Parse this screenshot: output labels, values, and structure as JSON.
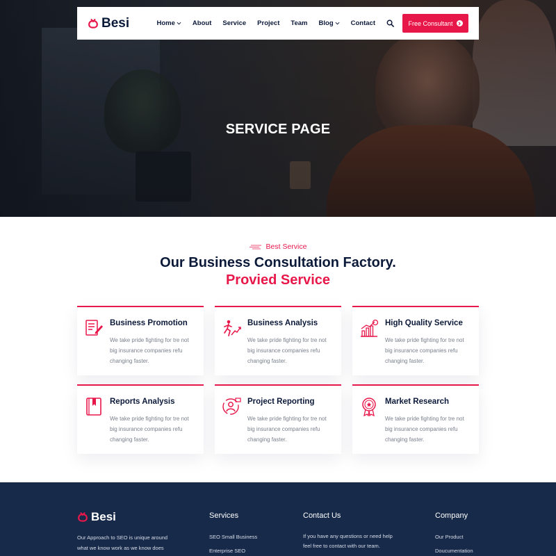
{
  "brand": {
    "name": "Besi",
    "accent": "#e8174a",
    "dark": "#0c1a3a",
    "footer_bg": "#172a4a"
  },
  "nav": {
    "items": [
      {
        "label": "Home",
        "has_dropdown": true
      },
      {
        "label": "About",
        "has_dropdown": false
      },
      {
        "label": "Service",
        "has_dropdown": false
      },
      {
        "label": "Project",
        "has_dropdown": false
      },
      {
        "label": "Team",
        "has_dropdown": false
      },
      {
        "label": "Blog",
        "has_dropdown": true
      },
      {
        "label": "Contact",
        "has_dropdown": false
      }
    ],
    "search_icon": "search-icon",
    "cta_label": "Free Consultant"
  },
  "hero": {
    "title": "SERVICE PAGE"
  },
  "services": {
    "tagline": "Best Service",
    "heading": "Our Business Consultation Factory.",
    "subheading": "Provied Service",
    "cards": [
      {
        "title": "Business Promotion",
        "desc": "We take pride fighting for tre not big insurance companies refu changing faster.",
        "icon": "document-pen-icon"
      },
      {
        "title": "Business Analysis",
        "desc": "We take pride fighting for tre not big insurance companies refu changing faster.",
        "icon": "running-growth-icon"
      },
      {
        "title": "High Quality Service",
        "desc": "We take pride fighting for tre not big insurance companies refu changing faster.",
        "icon": "bar-chart-dollar-icon"
      },
      {
        "title": "Reports Analysis",
        "desc": "We take pride fighting for tre not big insurance companies refu changing faster.",
        "icon": "bookmark-book-icon"
      },
      {
        "title": "Project Reporting",
        "desc": "We take pride fighting for tre not big insurance companies refu changing faster.",
        "icon": "person-target-icon"
      },
      {
        "title": "Market Research",
        "desc": "We take pride fighting for tre not big insurance companies refu changing faster.",
        "icon": "award-badge-icon"
      }
    ]
  },
  "footer": {
    "brand": "Besi",
    "about": "Our Approach to SEO is unique around what we know work as we know does",
    "services_title": "Services",
    "services_links": [
      "SEO Small Business",
      "Enterprise SEO"
    ],
    "contact_title": "Contact Us",
    "contact_text": "If you have any questions or need help feel free to contact with our team.",
    "company_title": "Company",
    "company_links": [
      "Our Product",
      "Doucumentation"
    ]
  }
}
